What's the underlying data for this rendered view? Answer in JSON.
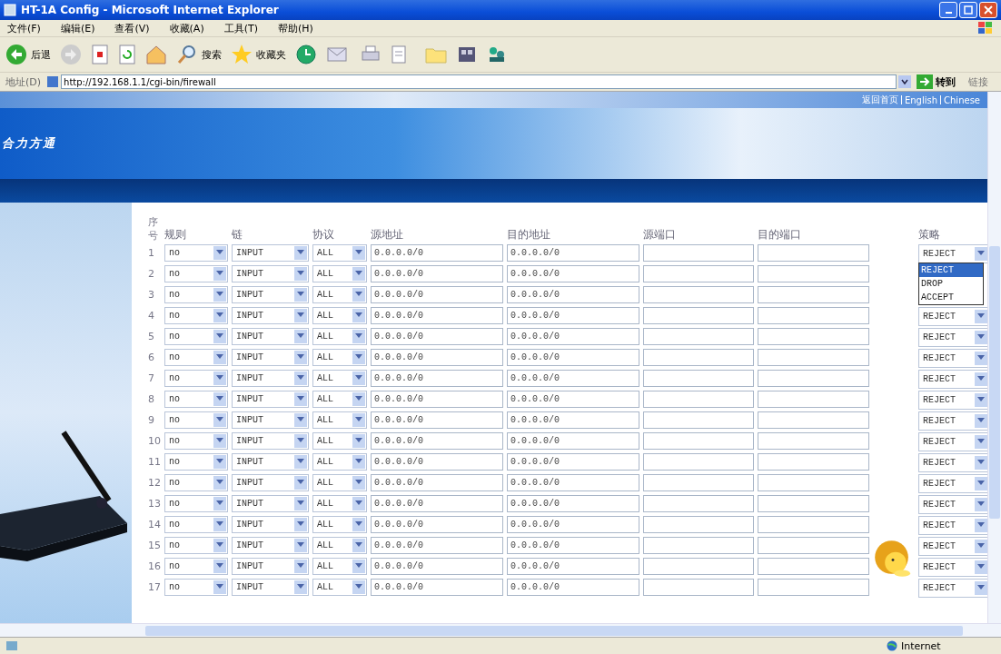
{
  "window": {
    "title": "HT-1A Config - Microsoft Internet Explorer"
  },
  "menu": [
    "文件(F)",
    "编辑(E)",
    "查看(V)",
    "收藏(A)",
    "工具(T)",
    "帮助(H)"
  ],
  "toolbar": {
    "back": "后退",
    "search": "搜索",
    "favorites": "收藏夹"
  },
  "address_bar": {
    "label": "地址(D)",
    "url": "http://192.168.1.1/cgi-bin/firewall",
    "go": "转到",
    "links": "链接"
  },
  "top_links": [
    "返回首页",
    "English",
    "Chinese"
  ],
  "logo": {
    "text": "合力方通"
  },
  "table": {
    "columns": [
      "序号",
      "规则",
      "链",
      "协议",
      "源地址",
      "目的地址",
      "源端口",
      "目的端口",
      "策略"
    ],
    "rows": [
      {
        "index": "1",
        "rule": "no",
        "chain": "INPUT",
        "protocol": "ALL",
        "source": "0.0.0.0/0",
        "destination": "0.0.0.0/0",
        "policy": "REJECT",
        "policy_menu": [
          {
            "label": "REJECT",
            "selected": true
          },
          {
            "label": "DROP",
            "selected": false
          },
          {
            "label": "ACCEPT",
            "selected": false
          }
        ]
      },
      {
        "index": "2",
        "rule": "no",
        "chain": "INPUT",
        "protocol": "ALL",
        "source": "0.0.0.0/0",
        "destination": "0.0.0.0/0"
      },
      {
        "index": "3",
        "rule": "no",
        "chain": "INPUT",
        "protocol": "ALL",
        "source": "0.0.0.0/0",
        "destination": "0.0.0.0/0"
      },
      {
        "index": "4",
        "rule": "no",
        "chain": "INPUT",
        "protocol": "ALL",
        "source": "0.0.0.0/0",
        "destination": "0.0.0.0/0",
        "policy": "REJECT"
      },
      {
        "index": "5",
        "rule": "no",
        "chain": "INPUT",
        "protocol": "ALL",
        "source": "0.0.0.0/0",
        "destination": "0.0.0.0/0",
        "policy": "REJECT"
      },
      {
        "index": "6",
        "rule": "no",
        "chain": "INPUT",
        "protocol": "ALL",
        "source": "0.0.0.0/0",
        "destination": "0.0.0.0/0",
        "policy": "REJECT"
      },
      {
        "index": "7",
        "rule": "no",
        "chain": "INPUT",
        "protocol": "ALL",
        "source": "0.0.0.0/0",
        "destination": "0.0.0.0/0",
        "policy": "REJECT"
      },
      {
        "index": "8",
        "rule": "no",
        "chain": "INPUT",
        "protocol": "ALL",
        "source": "0.0.0.0/0",
        "destination": "0.0.0.0/0",
        "policy": "REJECT"
      },
      {
        "index": "9",
        "rule": "no",
        "chain": "INPUT",
        "protocol": "ALL",
        "source": "0.0.0.0/0",
        "destination": "0.0.0.0/0",
        "policy": "REJECT"
      },
      {
        "index": "10",
        "rule": "no",
        "chain": "INPUT",
        "protocol": "ALL",
        "source": "0.0.0.0/0",
        "destination": "0.0.0.0/0",
        "policy": "REJECT"
      },
      {
        "index": "11",
        "rule": "no",
        "chain": "INPUT",
        "protocol": "ALL",
        "source": "0.0.0.0/0",
        "destination": "0.0.0.0/0",
        "policy": "REJECT"
      },
      {
        "index": "12",
        "rule": "no",
        "chain": "INPUT",
        "protocol": "ALL",
        "source": "0.0.0.0/0",
        "destination": "0.0.0.0/0",
        "policy": "REJECT"
      },
      {
        "index": "13",
        "rule": "no",
        "chain": "INPUT",
        "protocol": "ALL",
        "source": "0.0.0.0/0",
        "destination": "0.0.0.0/0",
        "policy": "REJECT"
      },
      {
        "index": "14",
        "rule": "no",
        "chain": "INPUT",
        "protocol": "ALL",
        "source": "0.0.0.0/0",
        "destination": "0.0.0.0/0",
        "policy": "REJECT"
      },
      {
        "index": "15",
        "rule": "no",
        "chain": "INPUT",
        "protocol": "ALL",
        "source": "0.0.0.0/0",
        "destination": "0.0.0.0/0",
        "policy": "REJECT"
      },
      {
        "index": "16",
        "rule": "no",
        "chain": "INPUT",
        "protocol": "ALL",
        "source": "0.0.0.0/0",
        "destination": "0.0.0.0/0",
        "policy": "REJECT"
      },
      {
        "index": "17",
        "rule": "no",
        "chain": "INPUT",
        "protocol": "ALL",
        "source": "0.0.0.0/0",
        "destination": "0.0.0.0/0",
        "policy": "REJECT"
      }
    ]
  },
  "status_bar": {
    "zone": "Internet"
  }
}
